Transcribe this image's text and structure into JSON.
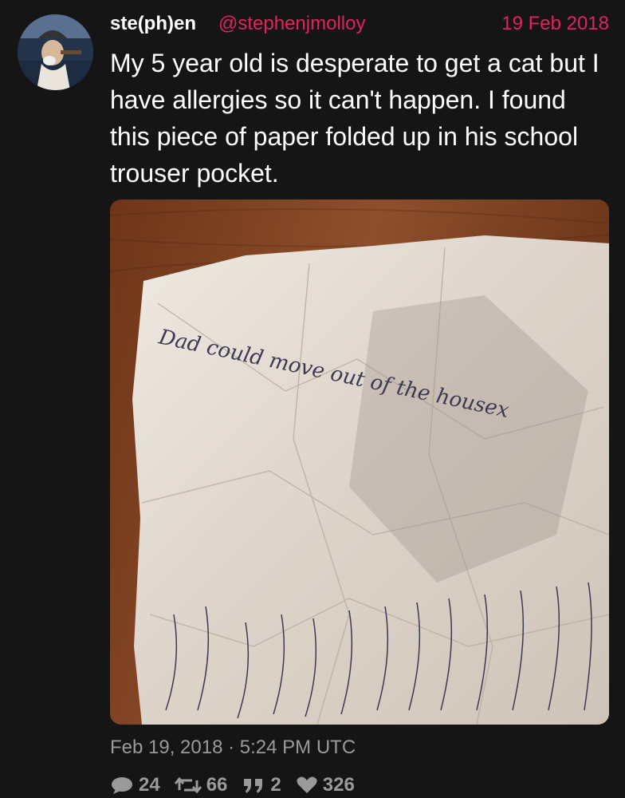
{
  "tweet": {
    "display_name": "ste(ph)en",
    "handle": "@stephenjmolloy",
    "date": "19 Feb 2018",
    "text": "My 5 year old is desperate to get a cat but I have allergies so it can't happen. I found this piece of paper folded up in his school trouser pocket.",
    "timestamp": "Feb 19, 2018 · 5:24 PM UTC"
  },
  "media": {
    "handwritten_note": "Dad could move out of the housex"
  },
  "stats": {
    "replies": "24",
    "retweets": "66",
    "quotes": "2",
    "likes": "326"
  },
  "icons": {
    "reply": "reply-icon",
    "retweet": "retweet-icon",
    "quote": "quote-icon",
    "like": "heart-icon"
  },
  "colors": {
    "background": "#151515",
    "accent": "#e0245e",
    "muted": "#9a9a9a"
  }
}
